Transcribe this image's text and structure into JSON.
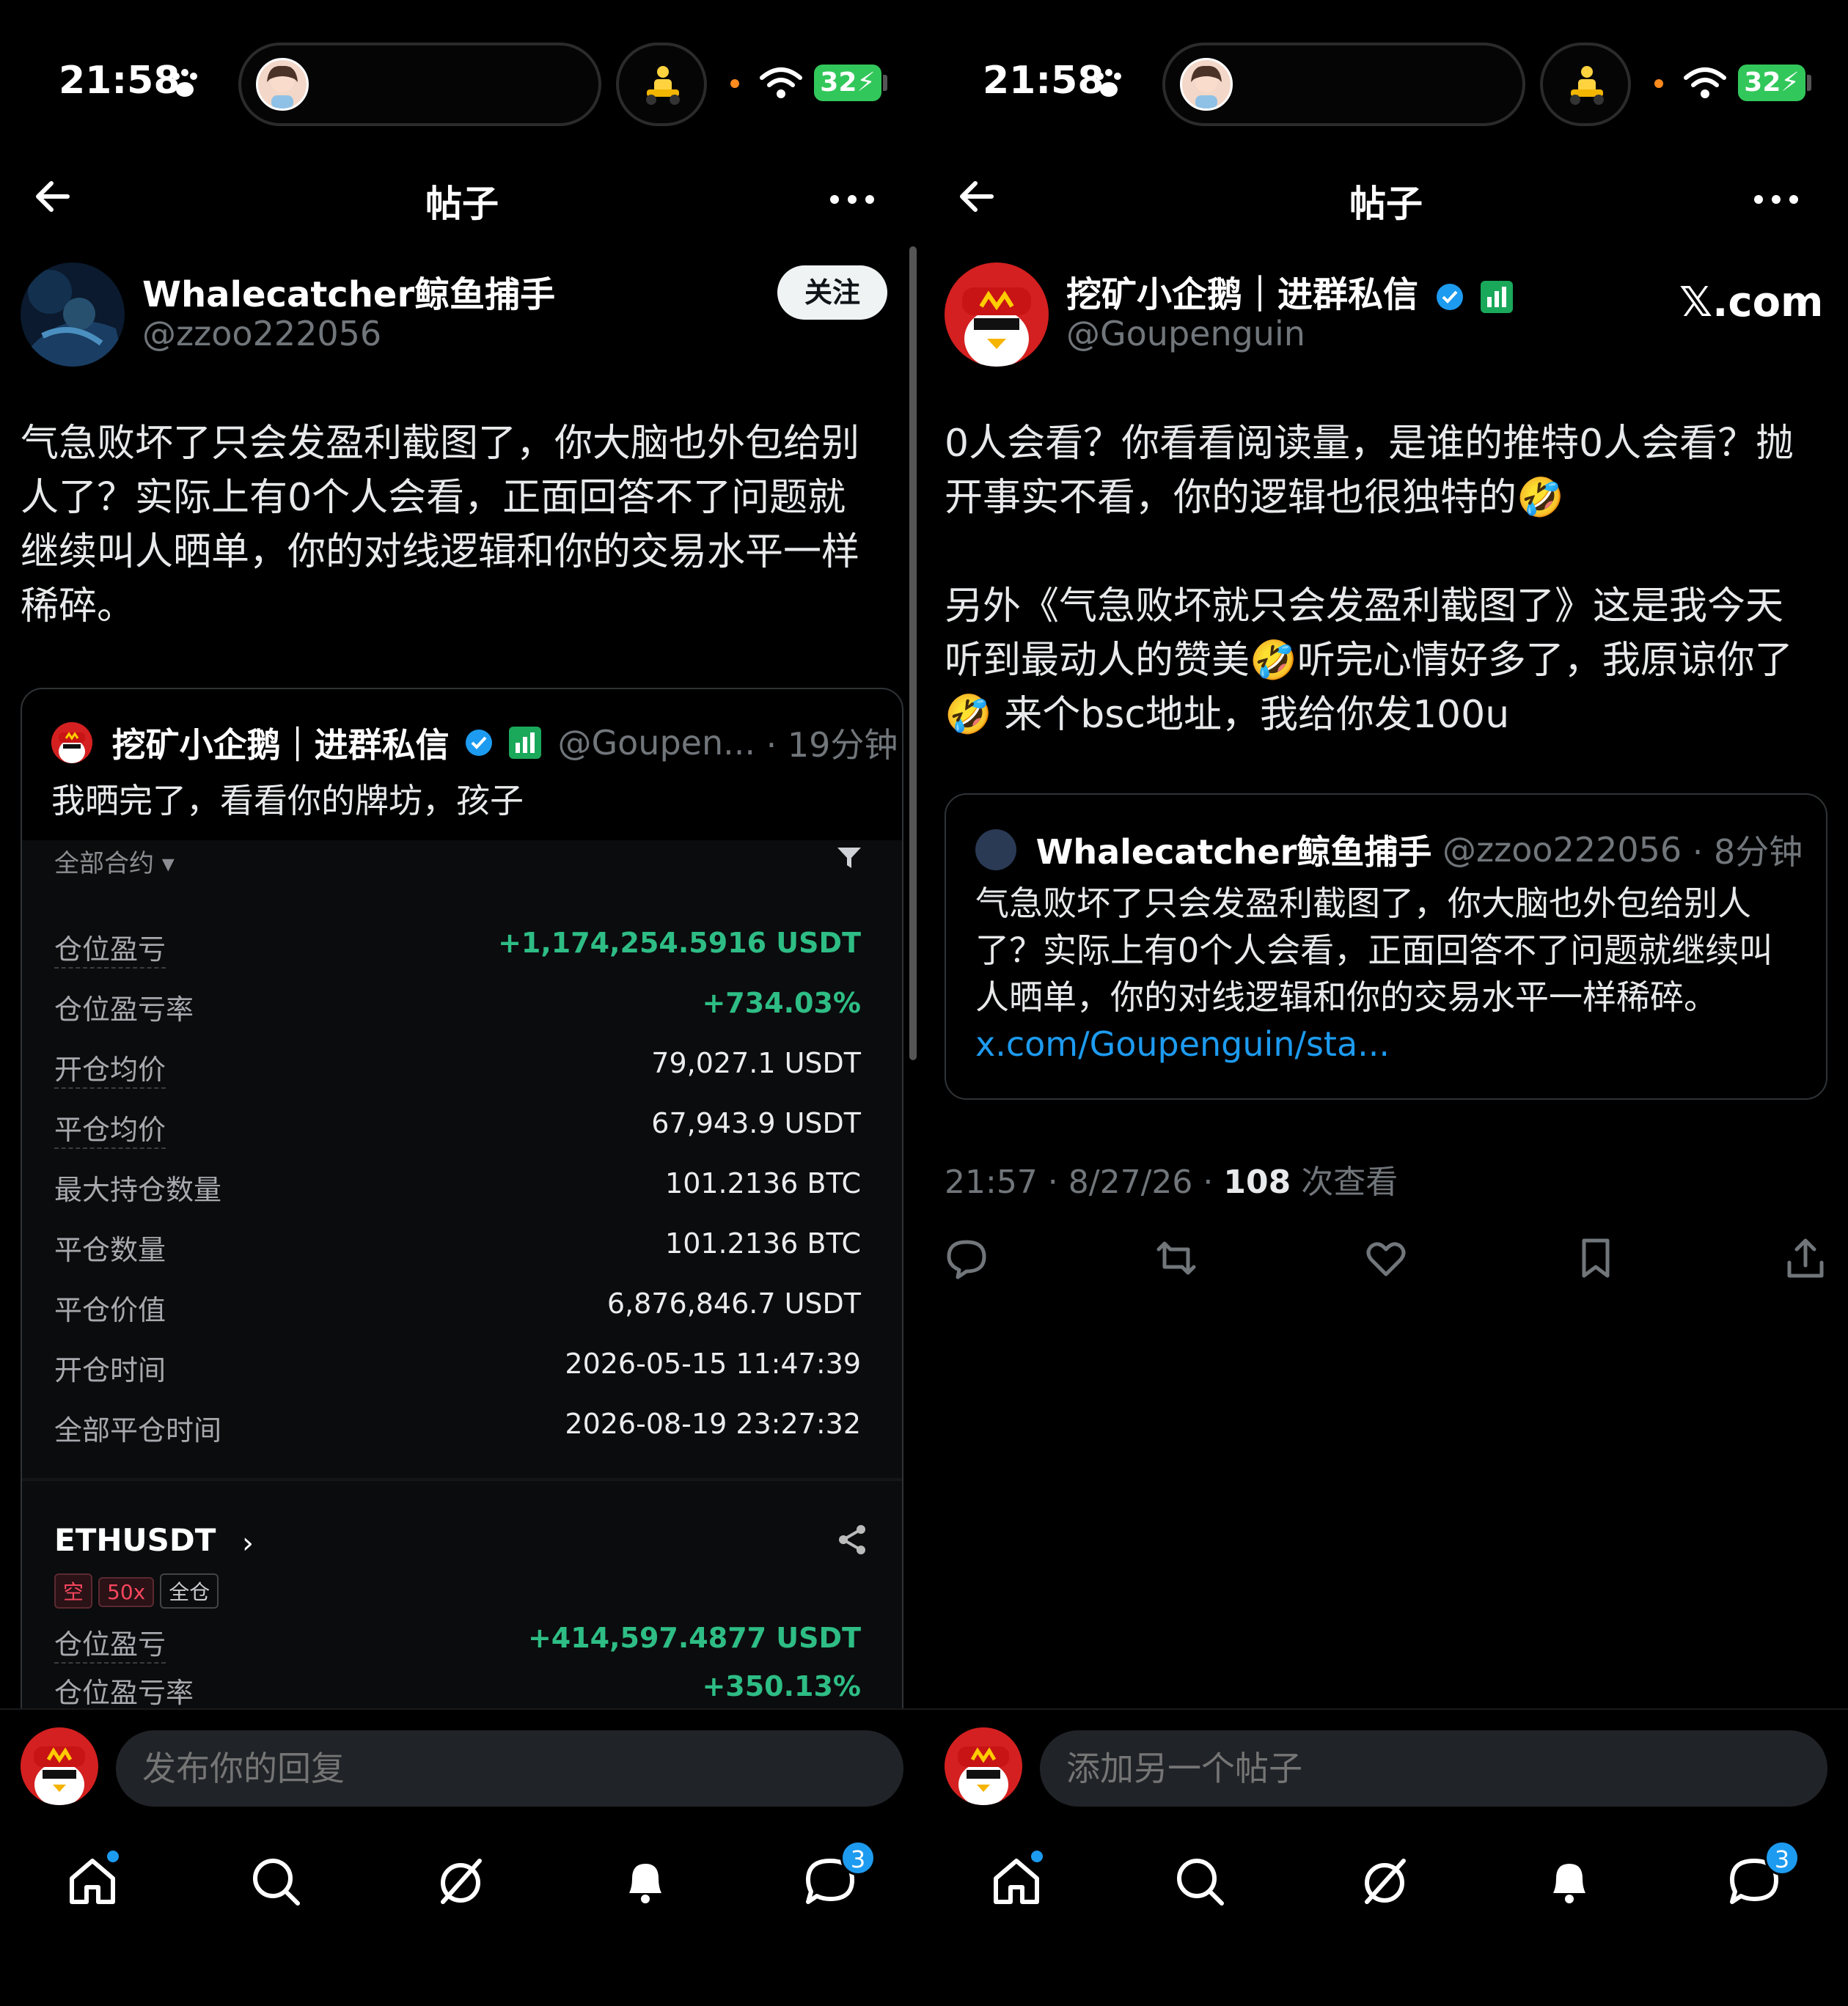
{
  "status_bar": {
    "time": "21:58",
    "battery": "32"
  },
  "left": {
    "header_title": "帖子",
    "author": {
      "name": "Whalecatcher鲸鱼捕手",
      "handle": "@zzoo222056",
      "follow_label": "关注"
    },
    "post_text": "气急败坏了只会发盈利截图了，你大脑也外包给别\n人了？实际上有0个人会看，正面回答不了问题就\n继续叫人晒单，你的对线逻辑和你的交易水平一样\n稀碎。",
    "quote": {
      "name": "挖矿小企鹅｜进群私信",
      "handle": "@Goupen...",
      "time": "· 19分钟",
      "text": "我晒完了，看看你的牌坊，孩子",
      "trade": {
        "filter_label": "全部合约 ▾",
        "rows": [
          {
            "label": "仓位盈亏",
            "value": "+1,174,254.5916 USDT",
            "green": true,
            "dashed": true
          },
          {
            "label": "仓位盈亏率",
            "value": "+734.03%",
            "green": true,
            "dashed": false
          },
          {
            "label": "开仓均价",
            "value": "79,027.1 USDT",
            "green": false,
            "dashed": true
          },
          {
            "label": "平仓均价",
            "value": "67,943.9 USDT",
            "green": false,
            "dashed": true
          },
          {
            "label": "最大持仓数量",
            "value": "101.2136 BTC",
            "green": false,
            "dashed": false
          },
          {
            "label": "平仓数量",
            "value": "101.2136 BTC",
            "green": false,
            "dashed": false
          },
          {
            "label": "平仓价值",
            "value": "6,876,846.7 USDT",
            "green": false,
            "dashed": false
          },
          {
            "label": "开仓时间",
            "value": "2026-05-15 11:47:39",
            "green": false,
            "dashed": false
          },
          {
            "label": "全部平仓时间",
            "value": "2026-08-19 23:27:32",
            "green": false,
            "dashed": false
          }
        ],
        "eth": {
          "symbol": "ETHUSDT",
          "chevron": "›",
          "tags": [
            "空",
            "50x",
            "全仓"
          ],
          "pnl_label": "仓位盈亏",
          "pnl_value": "+414,597.4877 USDT",
          "rate_label": "仓位盈亏率",
          "rate_value": "+350.13%"
        }
      }
    },
    "reply_placeholder": "发布你的回复",
    "messages_badge": "3"
  },
  "right": {
    "header_title": "帖子",
    "author": {
      "name": "挖矿小企鹅｜进群私信",
      "handle": "@Goupenguin"
    },
    "watermark": "𝕏.com",
    "post_text": "0人会看？你看看阅读量，是谁的推特0人会看？抛\n开事实不看，你的逻辑也很独特的🤣\n\n另外《气急败坏就只会发盈利截图了》这是我今天\n听到最动人的赞美🤣听完心情好多了，我原谅你了\n🤣 来个bsc地址，我给你发100u",
    "quote": {
      "name": "Whalecatcher鲸鱼捕手",
      "handle": "@zzoo222056",
      "time": "· 8分钟",
      "text": "气急败坏了只会发盈利截图了，你大脑也外包给别人了？实际上有0个人会看，正面回答不了问题就继续叫人晒单，你的对线逻辑和你的交易水平一样稀碎。",
      "link": "x.com/Goupenguin/sta..."
    },
    "meta_time": "21:57 · 8/27/26 · ",
    "meta_views": "108",
    "meta_views_label": " 次查看",
    "reply_placeholder": "添加另一个帖子",
    "messages_badge": "3"
  },
  "colors": {
    "accent": "#1d9bf0",
    "profit_green": "#2ebd85",
    "verified_blue": "#1d9bf0",
    "battery_green": "#32c75a"
  },
  "icons": [
    "back-arrow-icon",
    "more-icon",
    "verified-badge-icon",
    "reply-icon",
    "repost-icon",
    "like-icon",
    "bookmark-icon",
    "share-icon",
    "home-icon",
    "search-icon",
    "grok-icon",
    "notifications-icon",
    "messages-icon"
  ]
}
